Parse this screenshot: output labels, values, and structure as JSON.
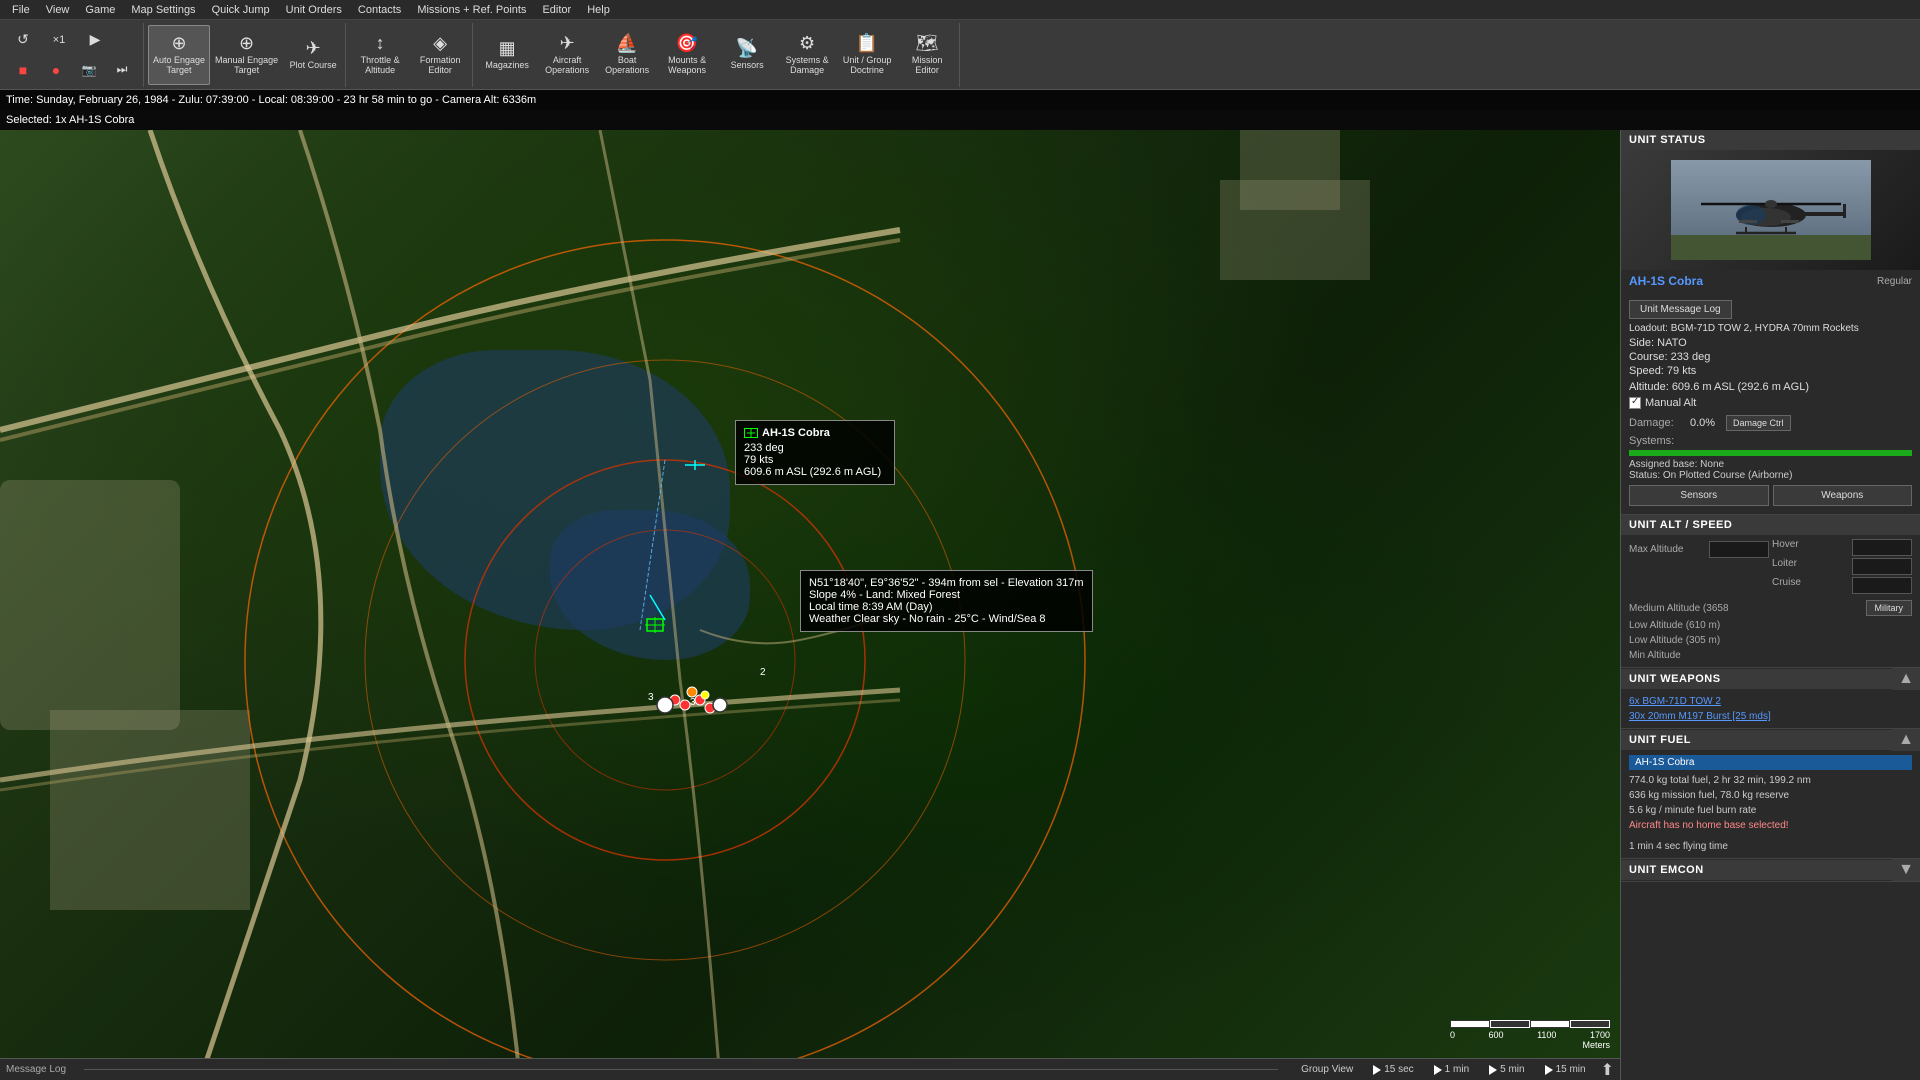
{
  "menubar": {
    "items": [
      "File",
      "View",
      "Game",
      "Map Settings",
      "Quick Jump",
      "Unit Orders",
      "Contacts",
      "Missions + Ref. Points",
      "Editor",
      "Help"
    ]
  },
  "toolbar": {
    "controls": {
      "loop": "↺",
      "speed": "×1",
      "stop": "■",
      "record": "●",
      "camera": "📷",
      "forward": "▶"
    },
    "buttons": [
      {
        "id": "auto-engage",
        "icon": "⊕",
        "label": "Auto Engage\nTarget"
      },
      {
        "id": "manual-engage",
        "icon": "⊕",
        "label": "Manual Engage\nTarget"
      },
      {
        "id": "plot-course",
        "icon": "✈",
        "label": "Plot Course"
      },
      {
        "id": "throttle-alt",
        "icon": "↕",
        "label": "Throttle &\nAltitude"
      },
      {
        "id": "formation",
        "icon": "◈",
        "label": "Formation\nEditor"
      },
      {
        "id": "magazines",
        "icon": "▦",
        "label": "Magazines"
      },
      {
        "id": "aircraft-ops",
        "icon": "✈",
        "label": "Aircraft\nOperations"
      },
      {
        "id": "boat-ops",
        "icon": "⛵",
        "label": "Boat\nOperations"
      },
      {
        "id": "mounts-weapons",
        "icon": "🔫",
        "label": "Mounts &\nWeapons"
      },
      {
        "id": "sensors",
        "icon": "📡",
        "label": "Sensors"
      },
      {
        "id": "systems-damage",
        "icon": "⚙",
        "label": "Systems &\nDamage"
      },
      {
        "id": "unit-doctrine",
        "icon": "📋",
        "label": "Unit / Group\nDoctrine"
      },
      {
        "id": "mission-editor",
        "icon": "🗺",
        "label": "Mission\nEditor"
      }
    ]
  },
  "timebar": {
    "text": "Time: Sunday, February 26, 1984 - Zulu: 07:39:00 - Local: 08:39:00 - 23 hr 58 min to go -  Camera Alt: 6336m"
  },
  "selected": {
    "label": "Selected:",
    "unit": "1x AH-1S Cobra"
  },
  "map": {
    "unit_popup": {
      "name": "AH-1S Cobra",
      "course": "233 deg",
      "speed": "79 kts",
      "altitude": "609.6 m ASL (292.6 m AGL)"
    },
    "coord_popup": {
      "coords": "N51°18'40\", E9°36'52\" - 394m from sel - Elevation 317m",
      "slope": "Slope 4% - Land: Mixed Forest",
      "local_time": "Local time 8:39 AM (Day)",
      "weather": "Weather Clear sky - No rain - 25°C - Wind/Sea 8"
    },
    "scale": {
      "labels": [
        "0",
        "600",
        "1100",
        "1700"
      ],
      "unit": "Meters"
    }
  },
  "right_panel": {
    "unit_status": {
      "header": "UNIT STATUS",
      "unit_name": "AH-1S Cobra",
      "badge": "Regular",
      "msg_log_btn": "Unit Message Log",
      "loadout": "Loadout: BGM-71D TOW 2, HYDRA 70mm Rockets",
      "side": "Side: NATO",
      "course": "Course: 233 deg",
      "speed": "Speed: 79 kts",
      "altitude_label": "Altitude:",
      "altitude_value": "609.6 m ASL (292.6 m AGL)",
      "manual_alt": "Manual Alt",
      "damage_label": "Damage:",
      "damage_value": "0.0%",
      "damage_btn": "Damage Ctrl",
      "systems_label": "Systems:",
      "assigned_base": "Assigned base: None",
      "status": "Status: On Plotted Course (Airborne)",
      "sensors_btn": "Sensors",
      "weapons_btn": "Weapons"
    },
    "unit_alt_speed": {
      "header": "UNIT ALT / SPEED",
      "max_altitude_label": "Max Altitude",
      "hover_label": "Hover",
      "loiter_label": "Loiter",
      "cruise_label": "Cruise",
      "medium_alt": "Medium Altitude (3658",
      "military_label": "Military",
      "low_alt_610": "Low Altitude (610 m)",
      "low_alt_305": "Low Altitude (305 m)",
      "min_altitude": "Min Altitude"
    },
    "unit_weapons": {
      "header": "UNIT WEAPONS",
      "weapon1": "6x BGM-71D TOW 2",
      "weapon2": "30x 20mm M197 Burst [25 mds]"
    },
    "unit_fuel": {
      "header": "UNIT FUEL",
      "unit_name": "AH-1S Cobra",
      "line1": "774.0 kg total fuel, 2 hr 32 min, 199.2 nm",
      "line2": "636 kg mission fuel, 78.0 kg reserve",
      "line3": "5.6 kg / minute fuel burn rate",
      "line4": "Aircraft has no home base selected!",
      "line5": "1 min 4 sec flying time"
    },
    "unit_emcon": {
      "header": "UNIT EMCON"
    }
  },
  "bottombar": {
    "message_log": "Message Log",
    "group_view": "Group View",
    "intervals": [
      "15 sec",
      "1 min",
      "5 min",
      "15 min"
    ]
  }
}
